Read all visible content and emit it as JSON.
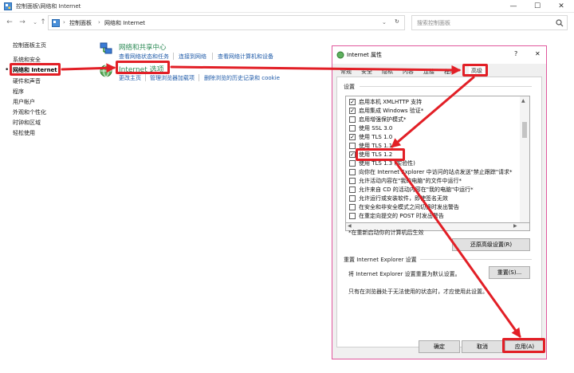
{
  "window": {
    "title": "控制面板\\网络和 Internet",
    "minimize": "—",
    "maximize": "☐",
    "close": "✕"
  },
  "nav": {
    "back": "←",
    "forward": "→",
    "up": "↑",
    "crumbs": [
      "控制面板",
      "网络和 Internet"
    ],
    "crumb_sep": "›",
    "dropdown": "⌄",
    "refresh": "↻",
    "search_placeholder": "搜索控制面板"
  },
  "sidebar": {
    "items": [
      "控制面板主页",
      "系统和安全",
      "网络和 Internet",
      "硬件和声音",
      "程序",
      "用户帐户",
      "外观和个性化",
      "时钟和区域",
      "轻松使用"
    ],
    "bullet": "•"
  },
  "main": {
    "network_center": {
      "title": "网络和共享中心",
      "links": [
        "查看网络状态和任务",
        "连接到网络",
        "查看网络计算机和设备"
      ]
    },
    "internet_options": {
      "title": "Internet 选项",
      "links": [
        "更改主页",
        "管理浏览器加载项",
        "删除浏览的历史记录和 cookie"
      ]
    }
  },
  "dialog": {
    "title": "Internet 属性",
    "help": "?",
    "close": "✕",
    "tabs": [
      "常规",
      "安全",
      "隐私",
      "内容",
      "连接",
      "程序",
      "高级"
    ],
    "settings_label": "设置",
    "options": [
      {
        "label": "启用本机 XMLHTTP 支持",
        "checked": true
      },
      {
        "label": "启用集成 Windows 验证*",
        "checked": true
      },
      {
        "label": "启用增强保护模式*",
        "checked": false
      },
      {
        "label": "使用 SSL 3.0",
        "checked": false
      },
      {
        "label": "使用 TLS 1.0",
        "checked": true
      },
      {
        "label": "使用 TLS 1.1",
        "checked": false
      },
      {
        "label": "使用 TLS 1.2",
        "checked": true
      },
      {
        "label": "使用 TLS 1.3 (实验性)",
        "checked": false
      },
      {
        "label": "向你在 Internet Explorer 中访问的站点发送\"禁止跟踪\"请求*",
        "checked": false
      },
      {
        "label": "允许活动内容在\"我的电脑\"的文件中运行*",
        "checked": false
      },
      {
        "label": "允许来自 CD 的活动内容在\"我的电脑\"中运行*",
        "checked": false
      },
      {
        "label": "允许运行或安装软件，即使签名无效",
        "checked": false
      },
      {
        "label": "在安全和非安全模式之间切换时发出警告",
        "checked": false
      },
      {
        "label": "在重定向提交的 POST 时发出警告",
        "checked": false
      }
    ],
    "restart_note": "*在重新启动你的计算机后生效",
    "restore_button": "还原高级设置(R)",
    "reset_group": "重置 Internet Explorer 设置",
    "reset_desc": "将 Internet Explorer 设置重置为默认设置。",
    "reset_button": "重置(S)...",
    "reset_note": "只有在浏览器处于无法使用的状态时，才应使用此设置。",
    "ok": "确定",
    "cancel": "取消",
    "apply": "应用(A)"
  },
  "colors": {
    "highlight": "#e21f26",
    "link": "#1e5aa8",
    "dialog_border": "#e0589d"
  }
}
